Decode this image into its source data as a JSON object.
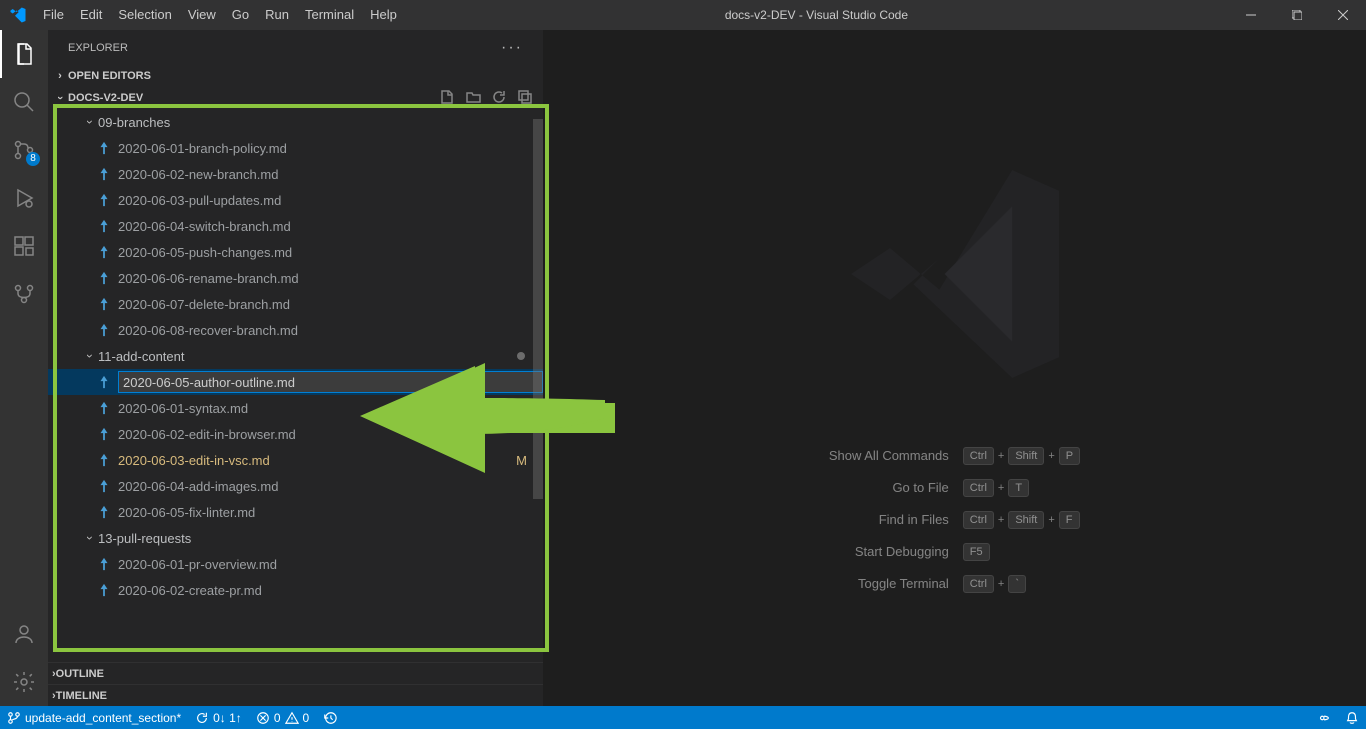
{
  "window": {
    "title": "docs-v2-DEV - Visual Studio Code"
  },
  "menus": [
    "File",
    "Edit",
    "Selection",
    "View",
    "Go",
    "Run",
    "Terminal",
    "Help"
  ],
  "activitybar": {
    "badge_scm": "8"
  },
  "explorer": {
    "title": "EXPLORER",
    "open_editors": "OPEN EDITORS",
    "workspace": "DOCS-V2-DEV",
    "outline": "OUTLINE",
    "timeline": "TIMELINE"
  },
  "tree": {
    "folders": [
      {
        "name": "09-branches",
        "children": [
          "2020-06-01-branch-policy.md",
          "2020-06-02-new-branch.md",
          "2020-06-03-pull-updates.md",
          "2020-06-04-switch-branch.md",
          "2020-06-05-push-changes.md",
          "2020-06-06-rename-branch.md",
          "2020-06-07-delete-branch.md",
          "2020-06-08-recover-branch.md"
        ]
      },
      {
        "name": "11-add-content",
        "children": [
          "2020-06-01-syntax.md",
          "2020-06-02-edit-in-browser.md",
          "2020-06-03-edit-in-vsc.md",
          "2020-06-04-add-images.md",
          "2020-06-05-fix-linter.md"
        ]
      },
      {
        "name": "13-pull-requests",
        "children": [
          "2020-06-01-pr-overview.md",
          "2020-06-02-create-pr.md"
        ]
      }
    ],
    "new_file_value": "2020-06-05-author-outline.md",
    "modified_file": "2020-06-03-edit-in-vsc.md",
    "modified_marker": "M"
  },
  "welcome_shortcuts": [
    {
      "label": "Show All Commands",
      "keys": [
        "Ctrl",
        "Shift",
        "P"
      ]
    },
    {
      "label": "Go to File",
      "keys": [
        "Ctrl",
        "T"
      ]
    },
    {
      "label": "Find in Files",
      "keys": [
        "Ctrl",
        "Shift",
        "F"
      ]
    },
    {
      "label": "Start Debugging",
      "keys": [
        "F5"
      ]
    },
    {
      "label": "Toggle Terminal",
      "keys": [
        "Ctrl",
        "`"
      ]
    }
  ],
  "statusbar": {
    "branch": "update-add_content_section*",
    "sync": "0↓ 1↑",
    "errors": "0",
    "warnings": "0"
  }
}
